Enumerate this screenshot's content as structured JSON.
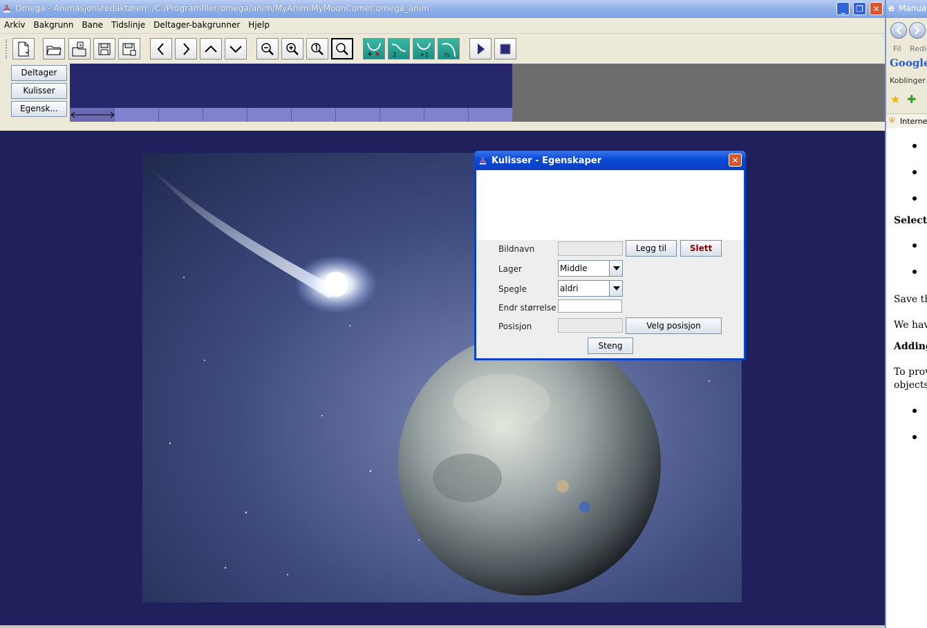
{
  "window": {
    "title": "Omega - Animasjonsredaktøren: /C:/Programfiler/omega/anim/MyAnim/MyMoonComet.omega_anim",
    "minimize_glyph": "_",
    "maximize_glyph": "❐",
    "close_glyph": "✕"
  },
  "menu": [
    "Arkiv",
    "Bakgrunn",
    "Bane",
    "Tidslinje",
    "Deltager-bakgrunner",
    "Hjelp"
  ],
  "toolbar_icons": [
    "new-file-icon",
    "open-folder-icon",
    "open-recent-icon",
    "save-icon",
    "save-as-icon",
    "previous-icon",
    "next-icon",
    "up-icon",
    "down-icon",
    "zoom-out-icon",
    "zoom-in-icon",
    "zoom-actual-icon",
    "zoom-fit-icon",
    "path-point-add-icon",
    "path-2-icon",
    "path-plus1-icon",
    "path-half-icon",
    "play-icon",
    "stop-icon"
  ],
  "toolbar_green_labels": {
    "path2": "2",
    "plus1": "+1",
    "half": "½"
  },
  "side_buttons": [
    "Deltager",
    "Kulisser",
    "Egensk..."
  ],
  "colors": {
    "canvas_bg": "#20205d",
    "timeline_bg": "#27276b",
    "timeline_cell": "#8181cf",
    "dialog_frame": "#0b3fc5",
    "delete_text": "#8b0000"
  },
  "dialog": {
    "title": "Kulisser - Egenskaper",
    "fields": {
      "bildnavn_label": "Bildnavn",
      "lager_label": "Lager",
      "spegle_label": "Spegle",
      "endr_label": "Endr størrelse",
      "posisjon_label": "Posisjon"
    },
    "lager_value": "Middle",
    "spegle_value": "aldri",
    "buttons": {
      "add": "Legg til",
      "delete": "Slett",
      "pick_position": "Velg posisjon",
      "close": "Steng"
    }
  },
  "ie": {
    "title": "Manua",
    "menu_fil": "Fil",
    "menu_redig": "Redig",
    "google": "Google",
    "links": "Koblinger",
    "zone": "Internet",
    "lines": {
      "selecting": "Selectin",
      "save": "Save the",
      "we_have": "We have",
      "adding": "Adding",
      "to_prov": "To prov",
      "objects": "objects."
    }
  }
}
